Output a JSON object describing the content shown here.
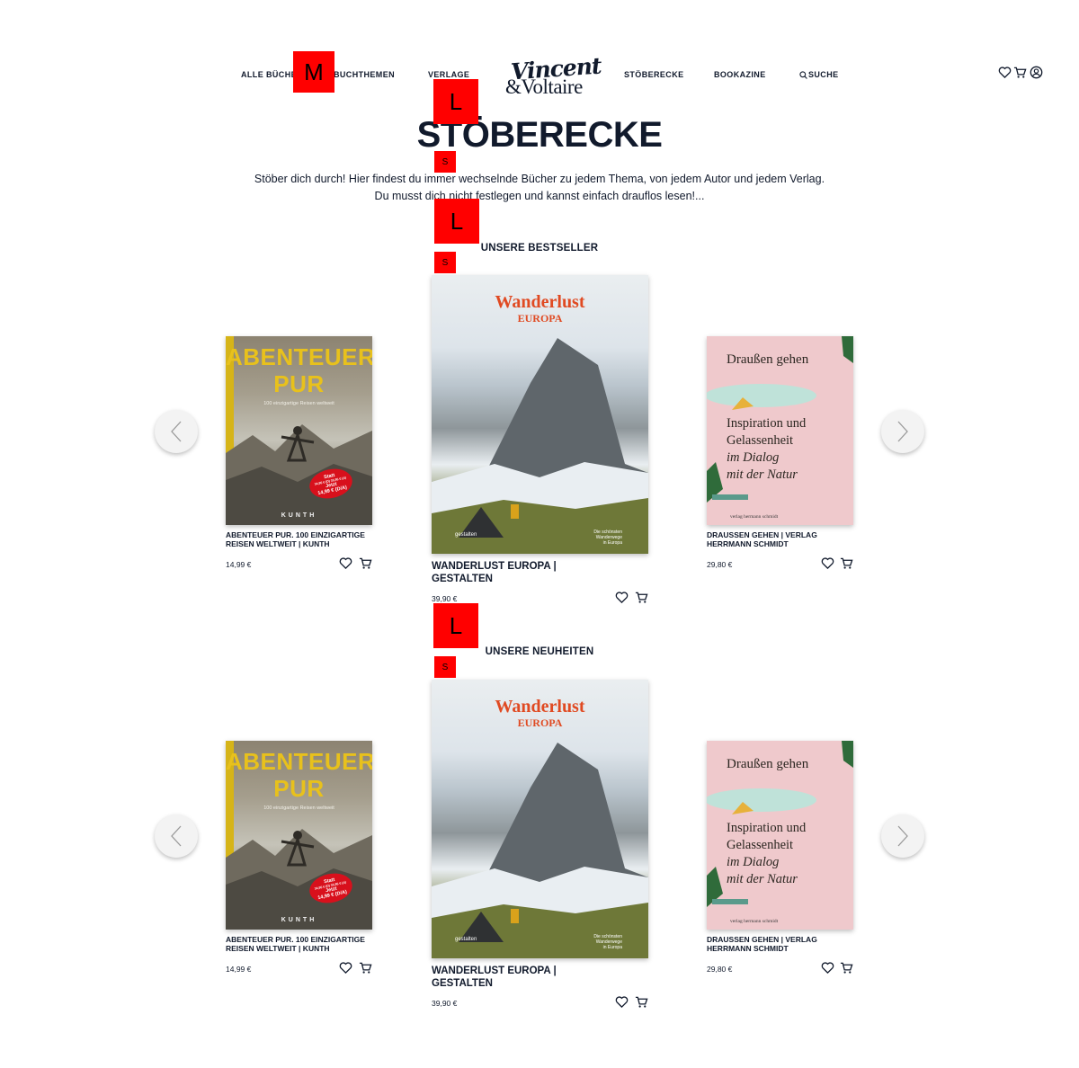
{
  "nav": {
    "items": [
      "ALLE BÜCHER",
      "BUCHTHEMEN",
      "VERLAGE",
      "STÖBERECKE",
      "BOOKAZINE",
      "SUCHE"
    ]
  },
  "logo": {
    "line1": "Vincent",
    "line2": "&Voltaire"
  },
  "header_icons": [
    "heart-icon",
    "cart-icon",
    "user-icon"
  ],
  "badges": {
    "m": "M",
    "l": "L",
    "s": "S"
  },
  "page": {
    "title": "STÖBERECKE",
    "intro_line1": "Stöber dich durch! Hier findest du immer wechselnde Bücher zu jedem Thema, von jedem Autor und jedem Verlag.",
    "intro_line2": "Du musst dich nicht festlegen und kannst einfach drauflos lesen!..."
  },
  "sections": [
    {
      "title": "UNSERE BESTSELLER",
      "books": [
        {
          "title": "ABENTEUER PUR. 100 EINZIGARTIGE REISEN WELTWEIT | KUNTH",
          "price": "14,99 €"
        },
        {
          "title": "WANDERLUST EUROPA | GESTALTEN",
          "price": "39,90 €"
        },
        {
          "title": "DRAUSSEN GEHEN | VERLAG HERRMANN SCHMIDT",
          "price": "29,80 €"
        }
      ]
    },
    {
      "title": "UNSERE NEUHEITEN",
      "books": [
        {
          "title": "ABENTEUER PUR. 100 EINZIGARTIGE REISEN WELTWEIT | KUNTH",
          "price": "14,99 €"
        },
        {
          "title": "WANDERLUST EUROPA | GESTALTEN",
          "price": "39,90 €"
        },
        {
          "title": "DRAUSSEN GEHEN | VERLAG HERRMANN SCHMIDT",
          "price": "29,80 €"
        }
      ]
    }
  ],
  "covers": {
    "abenteuer": {
      "title_line1": "ABENTEUER",
      "title_line2": "PUR",
      "subtitle": "100 einzigartige Reisen weltweit",
      "publisher": "KUNTH",
      "sticker_line1": "Statt",
      "sticker_line2": "34,95 € (D) 35,95 € (A)",
      "sticker_line3": "Jetzt",
      "sticker_line4": "14,99 € (D/A)"
    },
    "wanderlust": {
      "title_line1": "Wanderlust",
      "title_line2": "EUROPA",
      "publisher": "gestalten",
      "tagline_line1": "Die schönsten Wanderwege",
      "tagline_line2": "in Europa"
    },
    "draussen": {
      "title": "Draußen gehen",
      "sub_line1": "Inspiration und",
      "sub_line2": "Gelassenheit",
      "sub_line3": "im Dialog",
      "sub_line4": "mit der Natur",
      "publisher": "verlag hermann schmidt"
    }
  },
  "colors": {
    "text": "#111a2c",
    "badge": "#ff0000",
    "abenteuer_title": "#e8c11c",
    "wanderlust_title": "#e04a22",
    "draussen_bg": "#efc9cc"
  }
}
